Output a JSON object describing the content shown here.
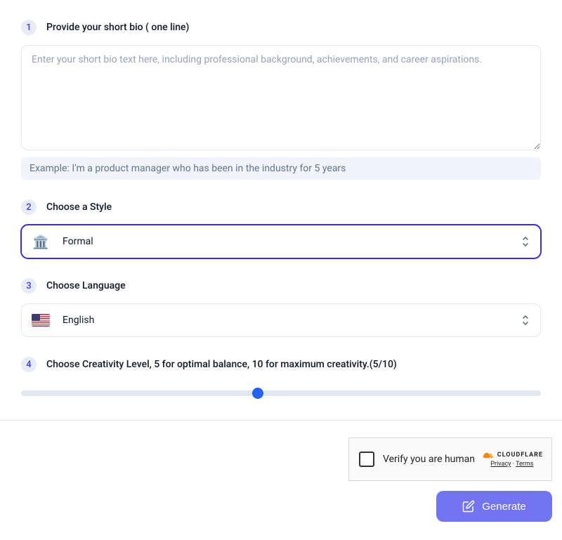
{
  "step1": {
    "number": "1",
    "label": "Provide your short bio  ( one line)",
    "placeholder": "Enter your short bio text here, including professional background, achievements, and career aspirations.",
    "example_prefix": "Example:  ",
    "example_text": "I'm a product manager who has been in the industry for 5 years"
  },
  "step2": {
    "number": "2",
    "label": "Choose a Style",
    "icon": "🏛️",
    "value": "Formal"
  },
  "step3": {
    "number": "3",
    "label": "Choose Language",
    "value": "English"
  },
  "step4": {
    "number": "4",
    "label_prefix": "Choose Creativity Level, 5 for optimal balance, 10 for maximum creativity.",
    "label_suffix": "(5/10)",
    "value": 5,
    "min": 0,
    "max": 10
  },
  "captcha": {
    "text": "Verify you are human",
    "brand": "CLOUDFLARE",
    "privacy": "Privacy",
    "dot": " · ",
    "terms": "Terms"
  },
  "generate": {
    "label": "Generate"
  }
}
